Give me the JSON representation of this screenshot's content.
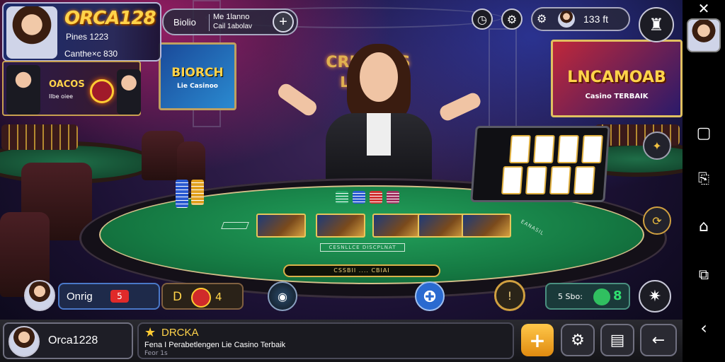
{
  "player": {
    "brand": "ORCA128",
    "line1": "Pines 1223",
    "line2": "Canthe×c 830"
  },
  "promo": {
    "text1": "OACOS",
    "text2": "Ilbe oiee"
  },
  "top_pill": {
    "label": "Biolio",
    "line1": "Me 1lanno",
    "line2": "Cail 1abolav"
  },
  "top_right": {
    "count": "133 ft"
  },
  "screens": {
    "left_title": "BIORCH",
    "left_sub": "Lie Casinoo",
    "center_top": "CRUEOOS",
    "center_bottom": "LOOGN",
    "right_title": "LNCAMOAB",
    "right_sub": "Casino TERBAIK"
  },
  "table": {
    "felt_label": "CESNLLCE DISCPLNAT",
    "bet_bar": "CSSBII .... CBIAI",
    "side_mark": "EANASIL"
  },
  "mid_row": {
    "name": "Onrig",
    "badge": "5",
    "chips_value": "4",
    "chips_prefix": "D",
    "credits_label": "5 Sbo:",
    "credits_value": "8"
  },
  "bottom": {
    "username": "Orca1228",
    "title": "DRCKA",
    "subtitle": "Fena I Perabetlengen Lie Casino Terbaik",
    "caption": "Feor 1s"
  },
  "colors": {
    "accent_gold": "#ffd34a",
    "felt_green": "#1a8c4e",
    "plus_orange": "#f5a623",
    "nav_bg": "#000000"
  },
  "icons": {
    "top_pill_plus": "plus-icon",
    "clock": "clock-icon",
    "settings": "gear-icon",
    "trophy": "trophy-icon",
    "profile_square": "profile-icon",
    "close": "close-icon",
    "android_square": "recents-icon",
    "android_share": "share-icon",
    "android_home": "home-icon",
    "android_copy": "copy-icon",
    "android_back": "back-icon"
  }
}
